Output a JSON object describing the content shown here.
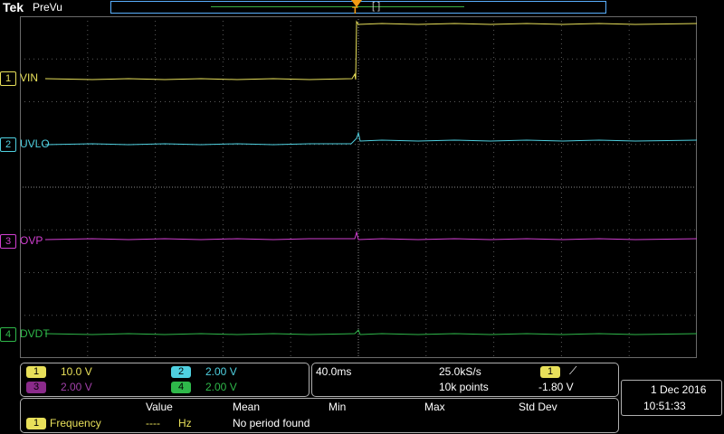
{
  "header": {
    "brand": "Tek",
    "mode": "PreVu",
    "trigger_marker": "T"
  },
  "channels": [
    {
      "id": "1",
      "name": "VIN",
      "color": "#e8e05a"
    },
    {
      "id": "2",
      "name": "UVLO",
      "color": "#4fd0e0"
    },
    {
      "id": "3",
      "name": "OVP",
      "color": "#d23fd2"
    },
    {
      "id": "4",
      "name": "DVDT",
      "color": "#2fb84a"
    }
  ],
  "vertical": [
    {
      "ch": "1",
      "scale": "10.0 V",
      "color": "#e8e05a"
    },
    {
      "ch": "2",
      "scale": "2.00 V",
      "color": "#4fd0e0"
    },
    {
      "ch": "3",
      "scale": "2.00 V",
      "color": "#d23fd2"
    },
    {
      "ch": "4",
      "scale": "2.00 V",
      "color": "#2fb84a"
    }
  ],
  "horizontal": {
    "timebase": "40.0ms",
    "sample_rate": "25.0kS/s",
    "record_length": "10k points",
    "trigger_source": "1",
    "trigger_slope": "⟋",
    "trigger_level": "-1.80 V"
  },
  "datetime": {
    "date": "1 Dec  2016",
    "time": "10:51:33"
  },
  "measurements": {
    "headers": [
      "Value",
      "Mean",
      "Min",
      "Max",
      "Std Dev"
    ],
    "rows": [
      {
        "ch": "1",
        "name": "Frequency",
        "value": "----",
        "unit": "Hz",
        "note": "No period found"
      }
    ]
  }
}
